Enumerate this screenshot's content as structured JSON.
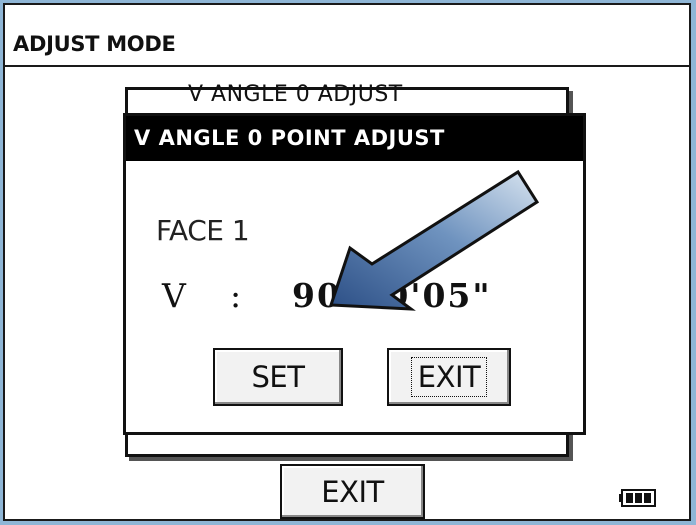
{
  "window": {
    "title": "ADJUST MODE"
  },
  "background_dialog": {
    "title": "V ANGLE 0 ADJUST"
  },
  "dialog": {
    "title": "V ANGLE 0 POINT ADJUST",
    "face_label": "FACE 1",
    "v_label": "V",
    "v_separator": ":",
    "v_value": "90°00'05\"",
    "set_label": "SET",
    "exit_label": "EXIT"
  },
  "footer": {
    "exit_label": "EXIT",
    "battery_icon": "battery-icon"
  },
  "annotation": {
    "arrow_icon": "arrow-icon",
    "arrow_color": "#4a74a8"
  },
  "colors": {
    "background": "#8fb6d6",
    "title_bar": "#000000",
    "text": "#111111"
  }
}
